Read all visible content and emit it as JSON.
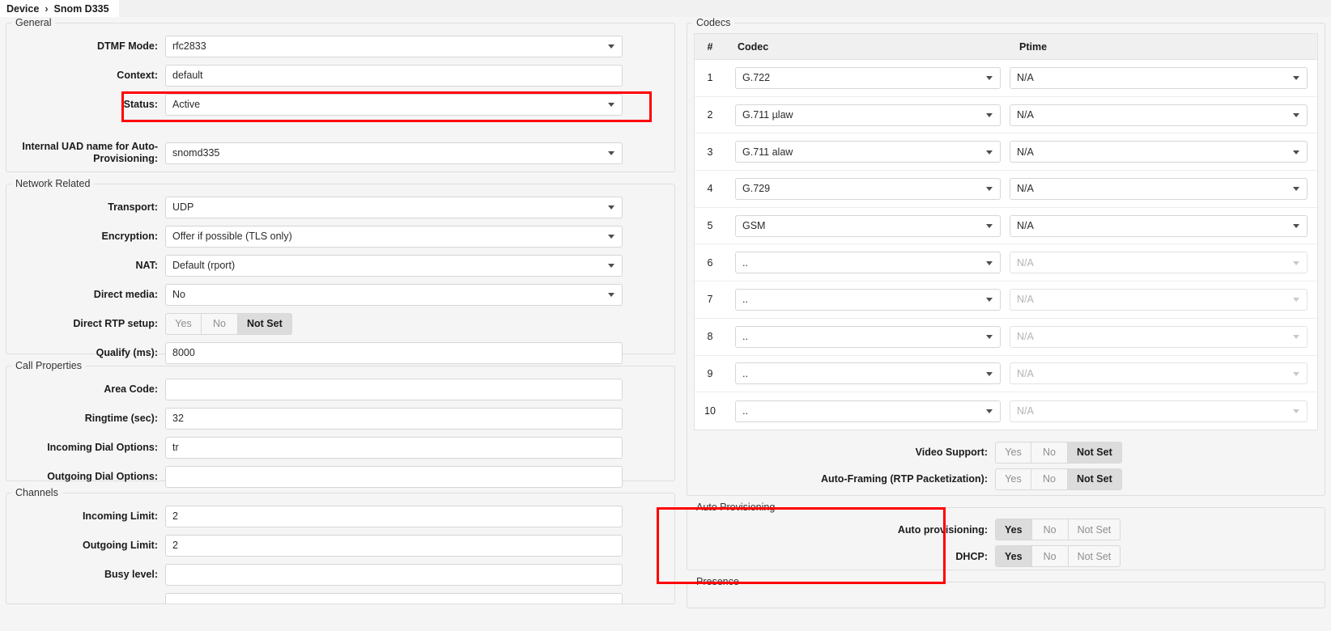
{
  "breadcrumb": {
    "root": "Device",
    "separator": "›",
    "current": "Snom D335"
  },
  "colors": {
    "highlight": "#ff0000",
    "panel_bg": "#f5f5f5",
    "selected_segment": "#dcdcdc"
  },
  "left": {
    "general": {
      "legend": "General",
      "fields": [
        {
          "label": "DTMF Mode:",
          "value": "rfc2833",
          "type": "select"
        },
        {
          "label": "Context:",
          "value": "default",
          "type": "text"
        },
        {
          "label": "Status:",
          "value": "Active",
          "type": "select",
          "highlighted": true
        },
        {
          "label": "Internal UAD name for Auto-Provisioning:",
          "value": "snomd335",
          "type": "select"
        }
      ]
    },
    "network": {
      "legend": "Network Related",
      "fields": [
        {
          "label": "Transport:",
          "value": "UDP",
          "type": "select"
        },
        {
          "label": "Encryption:",
          "value": "Offer if possible (TLS only)",
          "type": "select"
        },
        {
          "label": "NAT:",
          "value": "Default (rport)",
          "type": "select"
        },
        {
          "label": "Direct media:",
          "value": "No",
          "type": "select"
        },
        {
          "label": "Direct RTP setup:",
          "type": "segmented",
          "options": [
            "Yes",
            "No",
            "Not Set"
          ],
          "selected": "Not Set"
        },
        {
          "label": "Qualify (ms):",
          "value": "8000",
          "type": "text"
        }
      ]
    },
    "call_properties": {
      "legend": "Call Properties",
      "fields": [
        {
          "label": "Area Code:",
          "value": "",
          "type": "text"
        },
        {
          "label": "Ringtime (sec):",
          "value": "32",
          "type": "text"
        },
        {
          "label": "Incoming Dial Options:",
          "value": "tr",
          "type": "text"
        },
        {
          "label": "Outgoing Dial Options:",
          "value": "",
          "type": "text"
        }
      ]
    },
    "channels": {
      "legend": "Channels",
      "fields": [
        {
          "label": "Incoming Limit:",
          "value": "2",
          "type": "text"
        },
        {
          "label": "Outgoing Limit:",
          "value": "2",
          "type": "text"
        },
        {
          "label": "Busy level:",
          "value": "",
          "type": "text"
        }
      ]
    }
  },
  "right": {
    "codecs": {
      "legend": "Codecs",
      "columns": {
        "num": "#",
        "codec": "Codec",
        "ptime": "Ptime"
      },
      "rows": [
        {
          "num": "1",
          "codec": "G.722",
          "ptime": "N/A",
          "enabled": true
        },
        {
          "num": "2",
          "codec": "G.711 µlaw",
          "ptime": "N/A",
          "enabled": true
        },
        {
          "num": "3",
          "codec": "G.711 alaw",
          "ptime": "N/A",
          "enabled": true
        },
        {
          "num": "4",
          "codec": "G.729",
          "ptime": "N/A",
          "enabled": true
        },
        {
          "num": "5",
          "codec": "GSM",
          "ptime": "N/A",
          "enabled": true
        },
        {
          "num": "6",
          "codec": "..",
          "ptime": "N/A",
          "enabled": false
        },
        {
          "num": "7",
          "codec": "..",
          "ptime": "N/A",
          "enabled": false
        },
        {
          "num": "8",
          "codec": "..",
          "ptime": "N/A",
          "enabled": false
        },
        {
          "num": "9",
          "codec": "..",
          "ptime": "N/A",
          "enabled": false
        },
        {
          "num": "10",
          "codec": "..",
          "ptime": "N/A",
          "enabled": false
        }
      ],
      "toggles": [
        {
          "label": "Video Support:",
          "options": [
            "Yes",
            "No",
            "Not Set"
          ],
          "selected": "Not Set"
        },
        {
          "label": "Auto-Framing (RTP Packetization):",
          "options": [
            "Yes",
            "No",
            "Not Set"
          ],
          "selected": "Not Set"
        }
      ]
    },
    "auto_provisioning": {
      "legend": "Auto Provisioning",
      "highlighted": true,
      "toggles": [
        {
          "label": "Auto provisioning:",
          "options": [
            "Yes",
            "No",
            "Not Set"
          ],
          "selected": "Yes"
        },
        {
          "label": "DHCP:",
          "options": [
            "Yes",
            "No",
            "Not Set"
          ],
          "selected": "Yes"
        }
      ]
    },
    "presence": {
      "legend": "Presence"
    }
  }
}
